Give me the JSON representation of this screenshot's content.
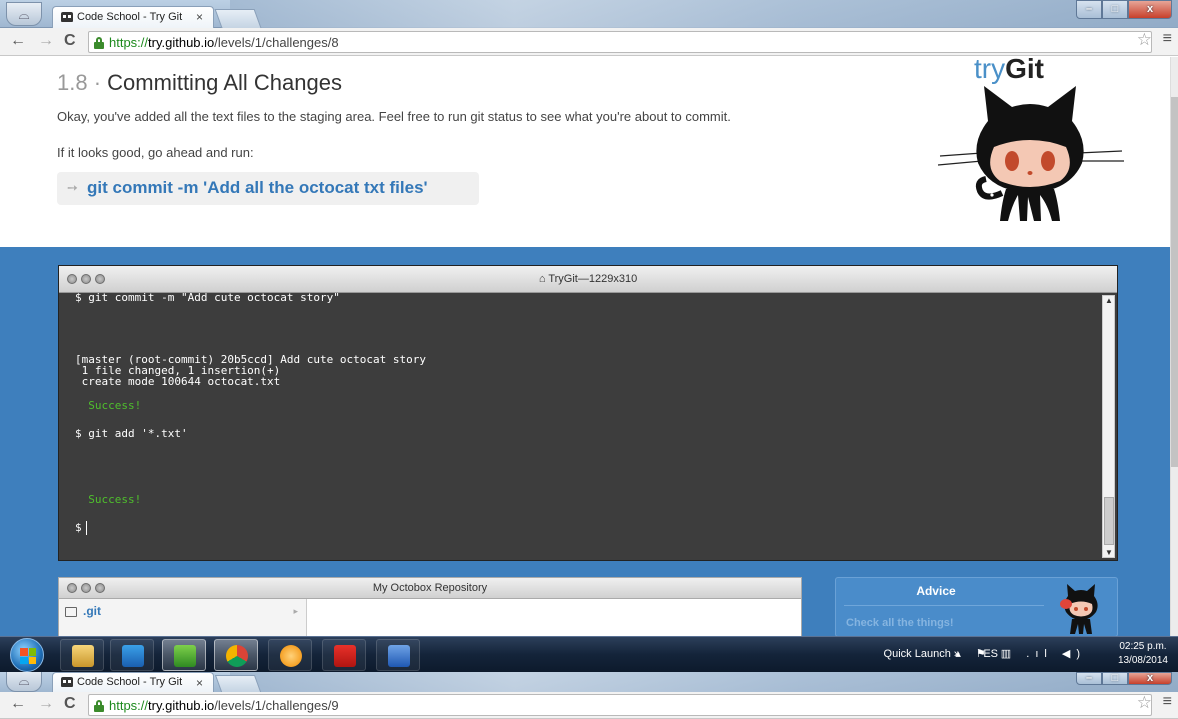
{
  "browser": {
    "tab_title": "Code School - Try Git",
    "tab_close": "×",
    "url_scheme": "https://",
    "url_host": "try.github.io",
    "url_path": "/levels/1/challenges/8",
    "back": "←",
    "forward": "→",
    "reload": "C",
    "star": "☆",
    "menu": "≡",
    "min": "–",
    "max": "□",
    "close": "x"
  },
  "challenge": {
    "number": "1.8",
    "separator": "·",
    "title": "Committing All Changes",
    "intro": "Okay, you've added all the text files to the staging area. Feel free to run git status to see what you're about to commit.",
    "instruction": "If it looks good, go ahead and run:",
    "command_arrow": "➙",
    "command": "git commit -m 'Add all the octocat txt files'"
  },
  "logo": {
    "prefix": "try",
    "suffix": "Git"
  },
  "terminal": {
    "title": "TryGit—1229x310",
    "lines": [
      "$ git commit -m \"Add cute octocat story\"",
      "[master (root-commit) 20b5ccd] Add cute octocat story",
      " 1 file changed, 1 insertion(+)",
      " create mode 100644 octocat.txt",
      "  Success!",
      "$ git add '*.txt'",
      "  Success!",
      "$"
    ]
  },
  "octobox": {
    "title": "My Octobox Repository",
    "folder": ".git",
    "chevron": "▸"
  },
  "advice": {
    "heading": "Advice",
    "text": "Check all the things!"
  },
  "taskbar": {
    "quick_launch": "Quick Launch",
    "chevron": "»",
    "lang": "ES",
    "tray_icons": "▴ ⚑ ▥ .ıl ◀)",
    "time": "02:25 p.m.",
    "date": "13/08/2014"
  },
  "second_window": {
    "tab_title": "Code School - Try Git",
    "tab_close": "×",
    "url_scheme": "https://",
    "url_host": "try.github.io",
    "url_path": "/levels/1/challenges/9"
  }
}
